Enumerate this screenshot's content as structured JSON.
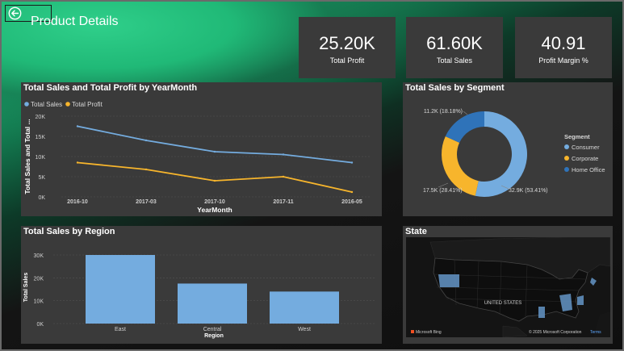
{
  "header": {
    "title": "Product Details"
  },
  "kpis": [
    {
      "value": "25.20K",
      "label": "Total Profit"
    },
    {
      "value": "61.60K",
      "label": "Total Sales"
    },
    {
      "value": "40.91",
      "label": "Profit Margin %"
    }
  ],
  "line_panel": {
    "title": "Total Sales and Total Profit by YearMonth",
    "legend": [
      "Total Sales",
      "Total Profit"
    ],
    "ylabel": "Total Sales and Total ...",
    "xlabel": "YearMonth",
    "yticks": [
      "0K",
      "5K",
      "10K",
      "15K",
      "20K"
    ]
  },
  "donut_panel": {
    "title": "Total Sales by Segment",
    "legend_title": "Segment",
    "labels": [
      "32.9K (53.41%)",
      "17.5K (28.41%)",
      "11.2K (18.18%)"
    ]
  },
  "bar_panel": {
    "title": "Total Sales by Region",
    "ylabel": "Total Sales",
    "xlabel": "Region",
    "yticks": [
      "0K",
      "10K",
      "20K",
      "30K"
    ]
  },
  "map_panel": {
    "title": "State",
    "label": "UNITED STATES",
    "brand": "Microsoft Bing",
    "copyright": "© 2025 Microsoft Corporation",
    "terms": "Terms"
  },
  "colors": {
    "sales": "#74acdf",
    "profit": "#f7b52c",
    "consumer": "#74acdf",
    "corporate": "#f7b52c",
    "home_office": "#2f73b9",
    "panel": "#3a3a3a",
    "accent": "#20b977"
  },
  "icons": {
    "back": "back-arrow-circle-icon"
  },
  "chart_data": [
    {
      "type": "line",
      "title": "Total Sales and Total Profit by YearMonth",
      "categories": [
        "2016-10",
        "2017-03",
        "2017-10",
        "2017-11",
        "2016-05"
      ],
      "series": [
        {
          "name": "Total Sales",
          "values": [
            17500,
            14000,
            11200,
            10500,
            8500
          ]
        },
        {
          "name": "Total Profit",
          "values": [
            8500,
            6800,
            4000,
            5000,
            1200
          ]
        }
      ],
      "xlabel": "YearMonth",
      "ylabel": "Total Sales and Total ...",
      "ylim": [
        0,
        20000
      ],
      "grid": true,
      "legend": "top-left"
    },
    {
      "type": "pie",
      "title": "Total Sales by Segment",
      "categories": [
        "Consumer",
        "Corporate",
        "Home Office"
      ],
      "values": [
        32.9,
        17.5,
        11.2
      ],
      "percentages": [
        53.41,
        28.41,
        18.18
      ],
      "legend": "right"
    },
    {
      "type": "bar",
      "title": "Total Sales by Region",
      "categories": [
        "East",
        "Central",
        "West"
      ],
      "values": [
        30000,
        17500,
        14000
      ],
      "xlabel": "Region",
      "ylabel": "Total Sales",
      "ylim": [
        0,
        30000
      ],
      "grid": true
    }
  ]
}
